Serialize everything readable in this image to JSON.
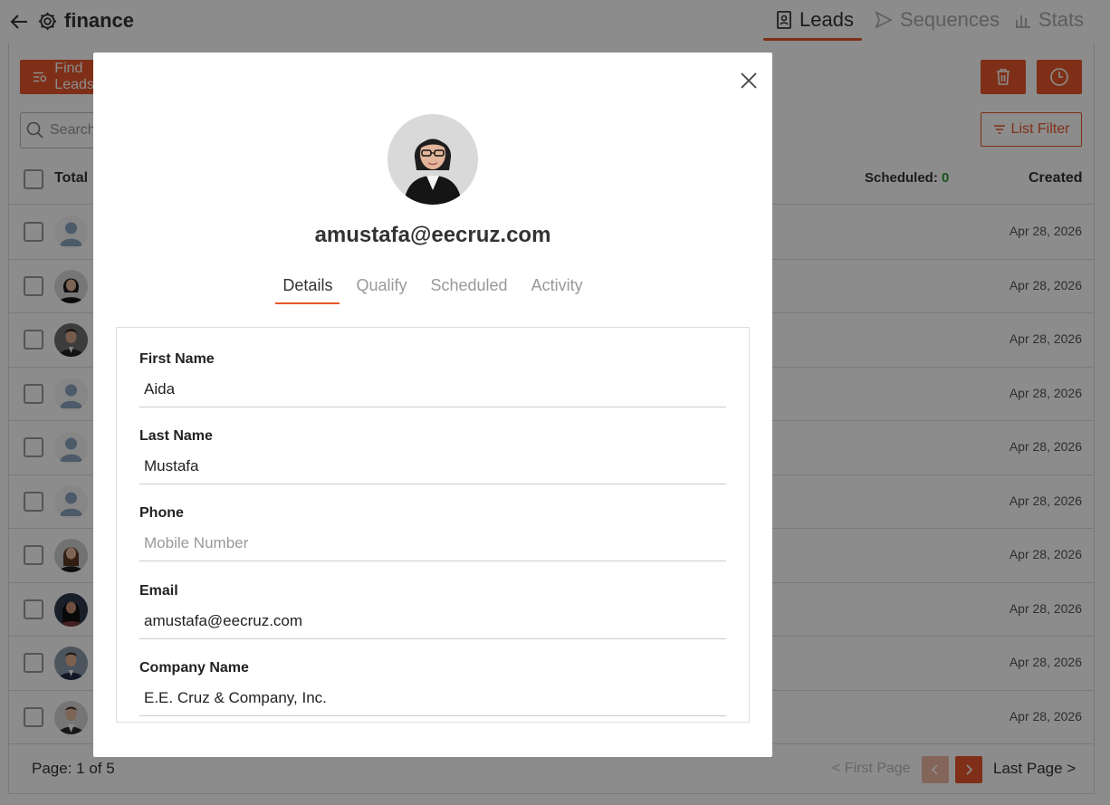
{
  "header": {
    "title": "finance",
    "tabs": [
      {
        "label": "Leads",
        "active": true
      },
      {
        "label": "Sequences",
        "active": false
      },
      {
        "label": "Stats",
        "active": false
      }
    ]
  },
  "toolbar": {
    "find_label": "Find Leads",
    "search_placeholder": "Search",
    "list_filter_label": "List Filter"
  },
  "table": {
    "total_label": "Total",
    "scheduled_label": "Scheduled:",
    "scheduled_count": "0",
    "created_label": "Created",
    "rows": [
      {
        "avatar": "placeholder",
        "created": "Apr 28, 2026"
      },
      {
        "avatar": "woman-glasses",
        "created": "Apr 28, 2026"
      },
      {
        "avatar": "man-dark-suit",
        "created": "Apr 28, 2026"
      },
      {
        "avatar": "placeholder",
        "created": "Apr 28, 2026"
      },
      {
        "avatar": "placeholder",
        "created": "Apr 28, 2026"
      },
      {
        "avatar": "placeholder",
        "created": "Apr 28, 2026"
      },
      {
        "avatar": "woman-brown-hair",
        "created": "Apr 28, 2026"
      },
      {
        "avatar": "woman-dark-hair",
        "created": "Apr 28, 2026"
      },
      {
        "avatar": "man-blue-suit",
        "created": "Apr 28, 2026"
      },
      {
        "avatar": "man-white-shirt",
        "created": "Apr 28, 2026"
      }
    ]
  },
  "pagination": {
    "page_label": "Page: 1 of 5",
    "first_label": "< First Page",
    "last_label": "Last Page >"
  },
  "modal": {
    "email_title": "amustafa@eecruz.com",
    "tabs": [
      {
        "label": "Details",
        "active": true
      },
      {
        "label": "Qualify",
        "active": false
      },
      {
        "label": "Scheduled",
        "active": false
      },
      {
        "label": "Activity",
        "active": false
      }
    ],
    "fields": [
      {
        "label": "First Name",
        "value": "Aida",
        "placeholder": ""
      },
      {
        "label": "Last Name",
        "value": "Mustafa",
        "placeholder": ""
      },
      {
        "label": "Phone",
        "value": "",
        "placeholder": "Mobile Number"
      },
      {
        "label": "Email",
        "value": "amustafa@eecruz.com",
        "placeholder": ""
      },
      {
        "label": "Company Name",
        "value": "E.E. Cruz & Company, Inc.",
        "placeholder": ""
      }
    ]
  },
  "colors": {
    "accent": "#e8572a",
    "success": "#2a9d3a"
  }
}
